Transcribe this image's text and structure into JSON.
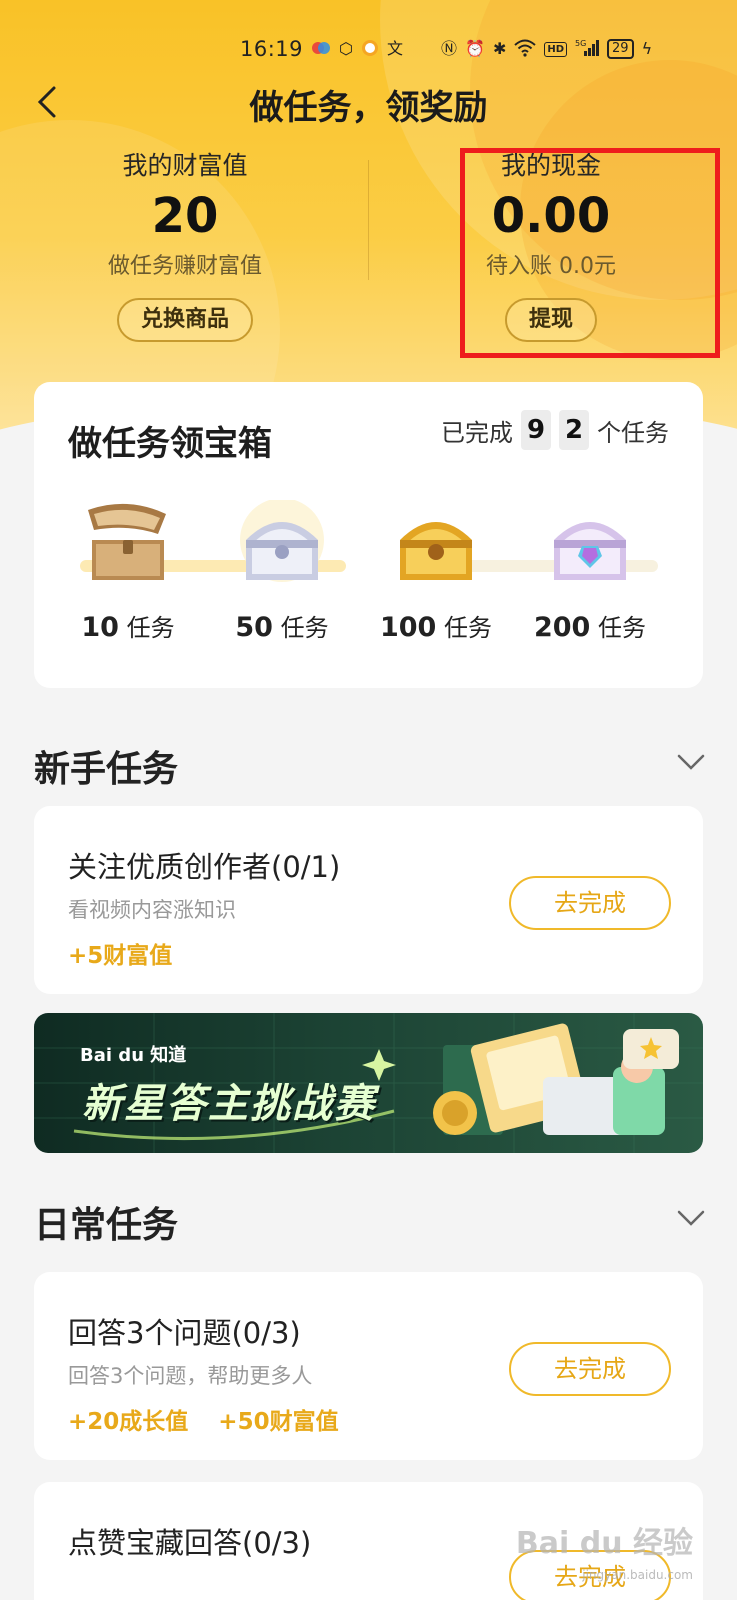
{
  "status_bar": {
    "time": "16:19",
    "battery": "29",
    "network": "5G",
    "hd_badge": "HD"
  },
  "header": {
    "title": "做任务，领奖励"
  },
  "wealth": {
    "label": "我的财富值",
    "value": "20",
    "sub": "做任务赚财富值",
    "button": "兑换商品"
  },
  "cash": {
    "label": "我的现金",
    "value": "0.00",
    "sub": "待入账 0.0元",
    "button": "提现"
  },
  "chest_card": {
    "title": "做任务领宝箱",
    "done_prefix": "已完成",
    "done_digits": [
      "9",
      "2"
    ],
    "done_suffix": "个任务",
    "progress_fraction": 0.46,
    "chests": [
      {
        "count": "10",
        "unit": "任务",
        "color": "bronze"
      },
      {
        "count": "50",
        "unit": "任务",
        "color": "silver"
      },
      {
        "count": "100",
        "unit": "任务",
        "color": "gold"
      },
      {
        "count": "200",
        "unit": "任务",
        "color": "crystal"
      }
    ]
  },
  "newbie_section": {
    "title": "新手任务",
    "tasks": [
      {
        "name": "关注优质创作者(0/1)",
        "desc": "看视频内容涨知识",
        "rewards": [
          "+5财富值"
        ],
        "button": "去完成"
      }
    ]
  },
  "banner": {
    "brand": "Bai du 知道",
    "title": "新星答主挑战赛"
  },
  "daily_section": {
    "title": "日常任务",
    "tasks": [
      {
        "name": "回答3个问题(0/3)",
        "desc": "回答3个问题，帮助更多人",
        "rewards": [
          "+20成长值",
          "+50财富值"
        ],
        "button": "去完成"
      },
      {
        "name": "点赞宝藏回答(0/3)",
        "button": "去完成"
      }
    ]
  },
  "watermark": {
    "text": "Bai du 经验",
    "sub": "jingyan.baidu.com"
  },
  "colors": {
    "accent": "#f0b92a",
    "reward": "#e8a91a",
    "highlight": "#ee1c1c",
    "header_bg": "#f9c227"
  }
}
